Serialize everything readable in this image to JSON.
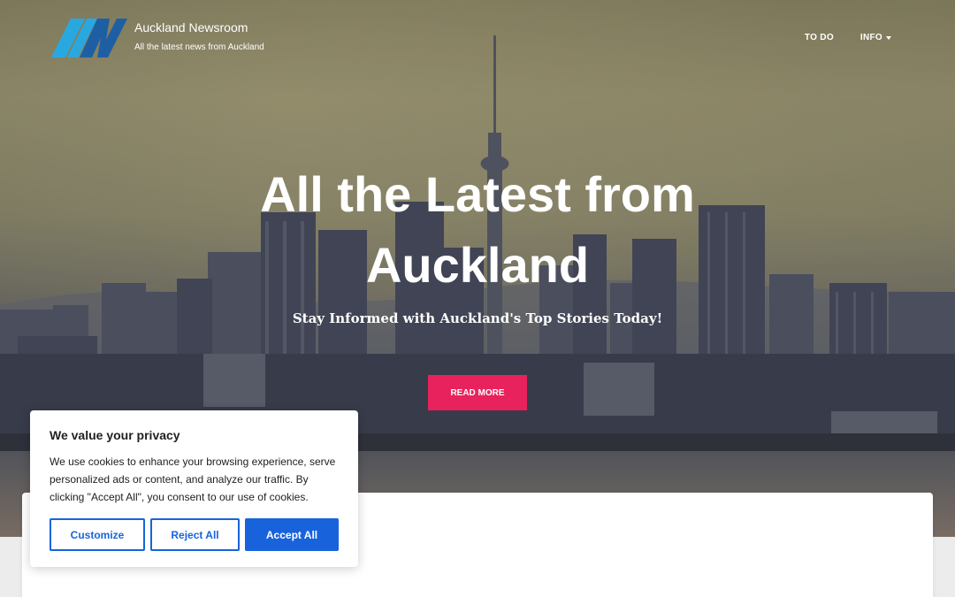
{
  "header": {
    "brand_name": "Auckland Newsroom",
    "tagline": "All the latest news from Auckland",
    "logo_icon": "an-logo-icon",
    "nav": [
      {
        "label": "TO DO"
      },
      {
        "label": "INFO"
      }
    ]
  },
  "hero": {
    "title": "All the Latest from Auckland",
    "subtitle": "Stay Informed with Auckland's Top Stories Today!",
    "cta_label": "READ MORE"
  },
  "cookie_banner": {
    "title": "We value your privacy",
    "text": "We use cookies to enhance your browsing experience, serve personalized ads or content, and analyze our traffic. By clicking \"Accept All\", you consent to our use of cookies.",
    "customize_label": "Customize",
    "reject_label": "Reject All",
    "accept_label": "Accept All"
  },
  "colors": {
    "cta": "#e8225c",
    "cookie_primary": "#1863dc",
    "logo_blue": "#29a8e0",
    "logo_navy": "#1e5fa3"
  }
}
